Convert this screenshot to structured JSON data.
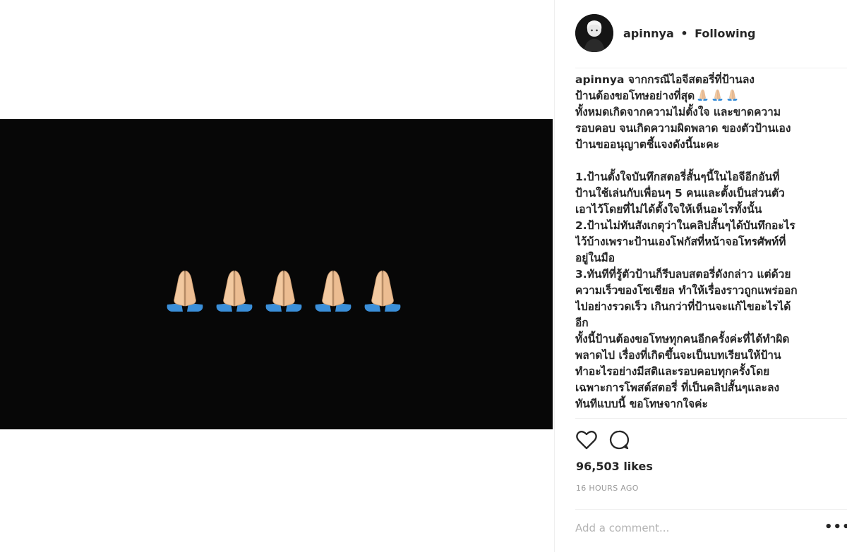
{
  "post": {
    "media": {
      "emoji_count": 5,
      "emoji_icon": "folded-hands-icon",
      "background": "#070707"
    },
    "header": {
      "username": "apinnya",
      "separator": "•",
      "follow_status": "Following",
      "avatar_icon": "user-avatar-icon"
    },
    "caption": {
      "username": "apinnya",
      "first_line_text": "จากกรณีไอจีสตอรี่ที่ป้านลง",
      "lines": [
        "ป้านต้องขอโทษอย่างที่สุด",
        "ทั้งหมดเกิดจากความไม่ตั้งใจ และขาดความ",
        "รอบคอบ จนเกิดความผิดพลาด ของตัวป้านเอง",
        "ป้านขออนุญาตชี้แจงดังนี้นะคะ",
        "",
        "1.ป้านตั้งใจบันทึกสตอรี่สั้นๆนี้ในไอจีอีกอันที่",
        "ป้านใช้เล่นกับเพื่อนๆ 5 คนและตั้งเป็นส่วนตัว",
        "เอาไว้โดยที่ไม่ได้ตั้งใจให้เห็นอะไรทั้งนั้น",
        "2.ป้านไม่ทันสังเกตุว่าในคลิปสั้นๆได้บันทึกอะไร",
        "ไว้บ้างเพราะป้านเองโฟกัสที่หน้าจอโทรศัพท์ที่",
        "อยู่ในมือ",
        "3.ทันทีที่รู้ตัวป้านก็รีบลบสตอรี่ดังกล่าว แต่ด้วย",
        "ความเร็วของโซเชียล ทำให้เรื่องราวถูกแพร่ออก",
        "ไปอย่างรวดเร็ว เกินกว่าที่ป้านจะแก้ไขอะไรได้",
        "อีก",
        "ทั้งนี้ป้านต้องขอโทษทุกคนอีกครั้งค่ะที่ได้ทำผิด",
        "พลาดไป เรื่องที่เกิดขึ้นจะเป็นบทเรียนให้ป้าน",
        "ทำอะไรอย่างมีสติและรอบคอบทุกครั้งโดย",
        "เฉพาะการโพสต์สตอรี่ ที่เป็นคลิปสั้นๆและลง",
        "ทันทีแบบนี้ ขอโทษจากใจค่ะ"
      ],
      "inline_emoji_count": 3
    },
    "actions": {
      "like_icon": "heart-icon",
      "comment_icon": "comment-bubble-icon"
    },
    "likes_text": "96,503 likes",
    "timestamp": "16 HOURS AGO",
    "comment_box": {
      "placeholder": "Add a comment...",
      "value": ""
    },
    "more_options": "•••",
    "more_icon": "more-options-icon"
  }
}
